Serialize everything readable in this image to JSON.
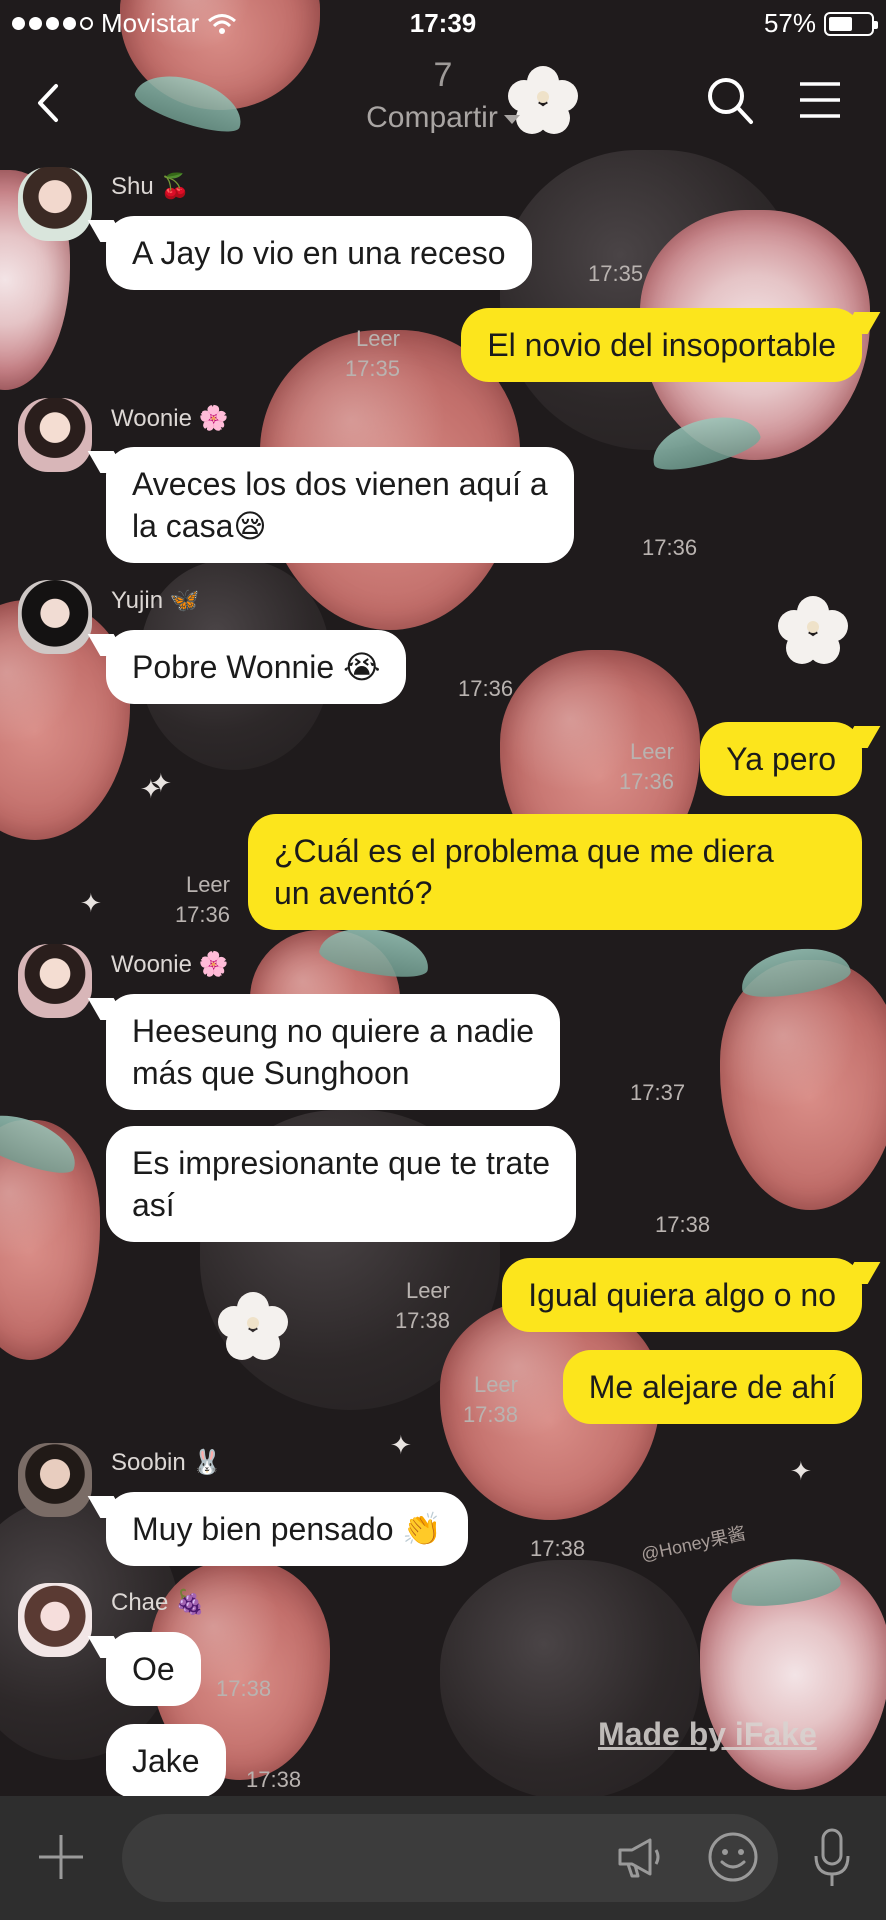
{
  "status_bar": {
    "carrier": "Movistar",
    "time": "17:39",
    "battery": "57%",
    "battery_level": 0.57
  },
  "header": {
    "member_count": "7",
    "subtitle": "Compartir"
  },
  "messages": [
    {
      "sender": "Shu",
      "emoji": "🍒",
      "text": "A Jay lo vio en una receso",
      "time": "17:35",
      "direction": "in"
    },
    {
      "text": "El novio del insoportable",
      "read": "Leer",
      "time": "17:35",
      "direction": "out"
    },
    {
      "sender": "Woonie",
      "emoji": "🌸",
      "text_lines": [
        "Aveces los dos vienen aquí a",
        "la casa😪"
      ],
      "time": "17:36",
      "direction": "in"
    },
    {
      "sender": "Yujin",
      "emoji": "🦋",
      "text": "Pobre Wonnie 😭",
      "time": "17:36",
      "direction": "in"
    },
    {
      "text": "Ya pero",
      "read": "Leer",
      "time": "17:36",
      "direction": "out"
    },
    {
      "text_lines": [
        "¿Cuál es el problema que me diera",
        "un aventó?"
      ],
      "read": "Leer",
      "time": "17:36",
      "direction": "out"
    },
    {
      "sender": "Woonie",
      "emoji": "🌸",
      "text_lines": [
        "Heeseung no quiere a nadie",
        "más que Sunghoon"
      ],
      "time": "17:37",
      "direction": "in"
    },
    {
      "text_lines": [
        "Es impresionante que te trate",
        "así"
      ],
      "time": "17:38",
      "direction": "in"
    },
    {
      "text": "Igual quiera algo o no",
      "read": "Leer",
      "time": "17:38",
      "direction": "out"
    },
    {
      "text": "Me alejare de ahí",
      "read": "Leer",
      "time": "17:38",
      "direction": "out"
    },
    {
      "sender": "Soobin",
      "emoji": "🐰",
      "text": "Muy bien pensado 👏",
      "time": "17:38",
      "direction": "in"
    },
    {
      "sender": "Chae",
      "emoji": "🍇",
      "text": "Oe",
      "time": "17:38",
      "direction": "in"
    },
    {
      "text": "Jake",
      "time": "17:38",
      "direction": "in"
    }
  ],
  "watermark": "@Honey果酱",
  "made_by": "Made by iFake",
  "input": {
    "placeholder": ""
  },
  "colors": {
    "incoming_bubble": "#ffffff",
    "outgoing_bubble": "#fce51c",
    "input_bar": "#2e2e2e"
  }
}
